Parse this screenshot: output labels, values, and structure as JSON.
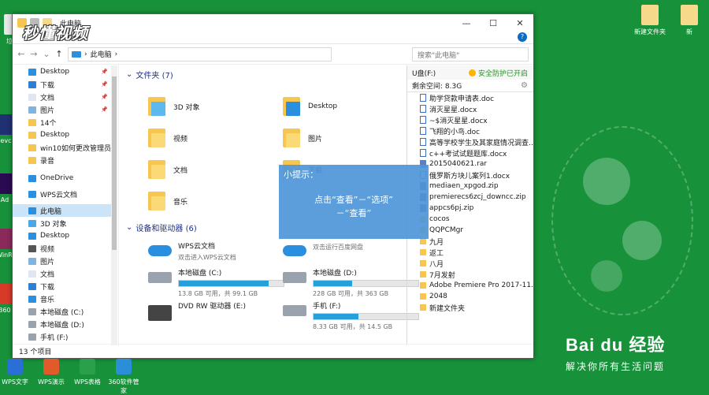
{
  "watermark": "秒懂视频",
  "window": {
    "title": "此电脑",
    "controls": [
      "—",
      "☐",
      "✕"
    ],
    "help": "?"
  },
  "address": {
    "path": "此电脑",
    "arrow": "›",
    "dropdown": "⌄",
    "refresh": "⟳"
  },
  "search": {
    "placeholder": "搜索\"此电脑\""
  },
  "nav_items": [
    {
      "label": "Desktop",
      "icon": "desktop-icon",
      "pinned": true
    },
    {
      "label": "下载",
      "icon": "download-icon",
      "pinned": true
    },
    {
      "label": "文档",
      "icon": "document-icon",
      "pinned": true
    },
    {
      "label": "图片",
      "icon": "picture-icon",
      "pinned": true
    },
    {
      "label": "14个",
      "icon": "folder-icon",
      "pinned": false
    },
    {
      "label": "Desktop",
      "icon": "folder-icon",
      "pinned": false
    },
    {
      "label": "win10如何更改管理员名",
      "icon": "folder-icon",
      "pinned": false
    },
    {
      "label": "录音",
      "icon": "folder-icon",
      "pinned": false
    },
    {
      "label": "OneDrive",
      "icon": "cloud-icon",
      "pinned": false
    },
    {
      "label": "WPS云文档",
      "icon": "wps-cloud-icon",
      "pinned": false
    },
    {
      "label": "此电脑",
      "icon": "computer-icon",
      "pinned": false,
      "selected": true
    },
    {
      "label": "3D 对象",
      "icon": "3d-objects-icon",
      "pinned": false
    },
    {
      "label": "Desktop",
      "icon": "desktop-icon",
      "pinned": false
    },
    {
      "label": "视频",
      "icon": "video-icon",
      "pinned": false
    },
    {
      "label": "图片",
      "icon": "picture-icon",
      "pinned": false
    },
    {
      "label": "文档",
      "icon": "document-icon",
      "pinned": false
    },
    {
      "label": "下载",
      "icon": "download-icon",
      "pinned": false
    },
    {
      "label": "音乐",
      "icon": "music-icon",
      "pinned": false
    },
    {
      "label": "本地磁盘 (C:)",
      "icon": "drive-icon",
      "pinned": false
    },
    {
      "label": "本地磁盘 (D:)",
      "icon": "drive-icon",
      "pinned": false
    },
    {
      "label": "手机 (F:)",
      "icon": "drive-icon",
      "pinned": false
    }
  ],
  "pin_glyph": "📌",
  "status": "13 个项目",
  "folders_header": "文件夹 (7)",
  "folders": [
    {
      "label": "3D 对象",
      "icon": "3d-objects-icon"
    },
    {
      "label": "Desktop",
      "icon": "desktop-icon"
    },
    {
      "label": "视频",
      "icon": "video-icon"
    },
    {
      "label": "图片",
      "icon": "picture-icon"
    },
    {
      "label": "文档",
      "icon": "document-icon"
    },
    {
      "label": "下载",
      "icon": "download-icon"
    },
    {
      "label": "音乐",
      "icon": "music-icon"
    }
  ],
  "drives_header": "设备和驱动器 (6)",
  "drives": [
    {
      "label": "WPS云文档",
      "sub": "双击进入WPS云文档",
      "icon": "wps-cloud-icon"
    },
    {
      "label": "",
      "sub": "双击运行百度网盘",
      "icon": "baidu-netdisk-icon"
    },
    {
      "label": "本地磁盘 (C:)",
      "sub": "13.8 GB 可用，共 99.1 GB",
      "icon": "windows-drive-icon",
      "used": 0.86
    },
    {
      "label": "本地磁盘 (D:)",
      "sub": "228 GB 可用，共 363 GB",
      "icon": "drive-icon",
      "used": 0.37
    },
    {
      "label": "DVD RW 驱动器 (E:)",
      "sub": "",
      "icon": "dvd-icon"
    },
    {
      "label": "手机 (F:)",
      "sub": "8.33 GB 可用，共 14.5 GB",
      "icon": "drive-icon",
      "used": 0.43
    }
  ],
  "usb_panel": {
    "title": "U盘(F:)",
    "safe": "安全防护已开启",
    "space": "剩余空间: 8.3G",
    "files": [
      {
        "name": "助学贷款申请表.doc",
        "type": "doc"
      },
      {
        "name": "消灭星星.docx",
        "type": "doc"
      },
      {
        "name": "~$消灭星星.docx",
        "type": "doc"
      },
      {
        "name": "飞翔的小鸟.doc",
        "type": "doc"
      },
      {
        "name": "高等学校学生及其家庭情况调查…",
        "type": "doc"
      },
      {
        "name": "c++考试试题题库.docx",
        "type": "doc"
      },
      {
        "name": "2015040621.rar",
        "type": "rar"
      },
      {
        "name": "俄罗斯方块儿案列1.docx",
        "type": "doc"
      },
      {
        "name": "mediaen_xpgod.zip",
        "type": "zip"
      },
      {
        "name": "premierecs6zcj_downcc.zip",
        "type": "zip"
      },
      {
        "name": "appcs6pj.zip",
        "type": "zip"
      },
      {
        "name": "cocos",
        "type": "fold"
      },
      {
        "name": "QQPCMgr",
        "type": "fold"
      },
      {
        "name": "九月",
        "type": "fold"
      },
      {
        "name": "返工",
        "type": "fold"
      },
      {
        "name": "八月",
        "type": "fold"
      },
      {
        "name": "7月发射",
        "type": "fold"
      },
      {
        "name": "Adobe Premiere Pro 2017-11.0",
        "type": "fold"
      },
      {
        "name": "2048",
        "type": "fold"
      },
      {
        "name": "新建文件夹",
        "type": "fold"
      }
    ]
  },
  "tip": {
    "title": "小提示：",
    "line1": "点击“查看”－“选项”",
    "line2": "－“查看”"
  },
  "desktop_icons": [
    {
      "label": "垃圾",
      "icon": "recycle-bin-icon"
    },
    {
      "label": "evcp",
      "icon": "app-icon"
    },
    {
      "label": "Ad",
      "icon": "adobe-icon"
    },
    {
      "label": "WinRA",
      "icon": "winrar-icon"
    },
    {
      "label": "360",
      "icon": "360-icon"
    },
    {
      "label": "新建文件夹",
      "icon": "folder-icon"
    },
    {
      "label": "新",
      "icon": "folder-icon"
    }
  ],
  "taskbar": [
    {
      "label": "WPS文字",
      "icon": "wps-writer-icon",
      "color": "#2a6fd6"
    },
    {
      "label": "WPS演示",
      "icon": "wps-presentation-icon",
      "color": "#e05a2a"
    },
    {
      "label": "WPS表格",
      "icon": "wps-spreadsheet-icon",
      "color": "#2aa04a"
    },
    {
      "label": "360软件管家",
      "icon": "360-manager-icon",
      "color": "#2a8fd6"
    }
  ],
  "brand": {
    "name": "Bai du 经验",
    "slogan": "解决你所有生活问题"
  }
}
